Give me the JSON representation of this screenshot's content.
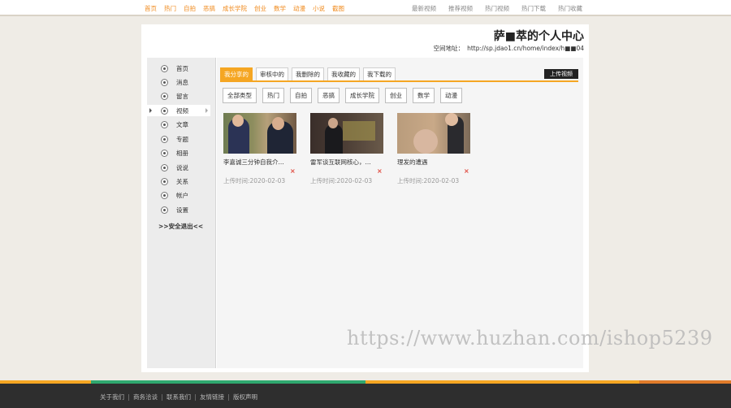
{
  "top_nav": {
    "left": [
      "首页",
      "热门",
      "自拍",
      "恶搞",
      "成长学院",
      "创业",
      "数学",
      "动漫",
      "小说",
      "截图"
    ],
    "right": [
      "最新视频",
      "推荐视频",
      "热门视频",
      "热门下载",
      "热门收藏"
    ]
  },
  "profile": {
    "title": "萨■萃的个人中心",
    "space_label": "空间地址：",
    "space_url": "http://sp.jdao1.cn/home/index/h■■04"
  },
  "sidebar": {
    "items": [
      {
        "label": "首页",
        "icon": "home-icon"
      },
      {
        "label": "消息",
        "icon": "message-icon"
      },
      {
        "label": "留言",
        "icon": "comment-icon"
      },
      {
        "label": "视频",
        "icon": "video-icon"
      },
      {
        "label": "文章",
        "icon": "article-icon"
      },
      {
        "label": "专题",
        "icon": "topic-icon"
      },
      {
        "label": "相册",
        "icon": "album-icon"
      },
      {
        "label": "说说",
        "icon": "chat-icon"
      },
      {
        "label": "关系",
        "icon": "relation-icon"
      },
      {
        "label": "帐户",
        "icon": "account-icon"
      },
      {
        "label": "设置",
        "icon": "settings-icon"
      }
    ],
    "active": "视频",
    "logout": ">>安全退出<<"
  },
  "tabs": [
    "我分享的",
    "审核中的",
    "我删除的",
    "我收藏的",
    "我下载的"
  ],
  "active_tab": "我分享的",
  "upload_label": "上传视频",
  "filters": [
    "全部类型",
    "热门",
    "自拍",
    "恶搞",
    "成长学院",
    "创业",
    "数学",
    "动漫"
  ],
  "videos": [
    {
      "title": "李嘉诚三分钟自我介...",
      "date": "上传时间:2020-02-03",
      "delete": "×"
    },
    {
      "title": "雷军谈互联网核心，...",
      "date": "上传时间:2020-02-03",
      "delete": "×"
    },
    {
      "title": "理发的遭遇",
      "date": "上传时间:2020-02-03",
      "delete": "×"
    }
  ],
  "watermark": "https://www.huzhan.com/ishop5239",
  "footer": [
    "关于我们",
    "商务洽谈",
    "联系我们",
    "友情链接",
    "版权声明"
  ],
  "colors": {
    "accent": "#f5a623",
    "nav_orange": "#f08a1c",
    "delete_red": "#e0463a",
    "footer_bg": "#2e2e2e"
  }
}
